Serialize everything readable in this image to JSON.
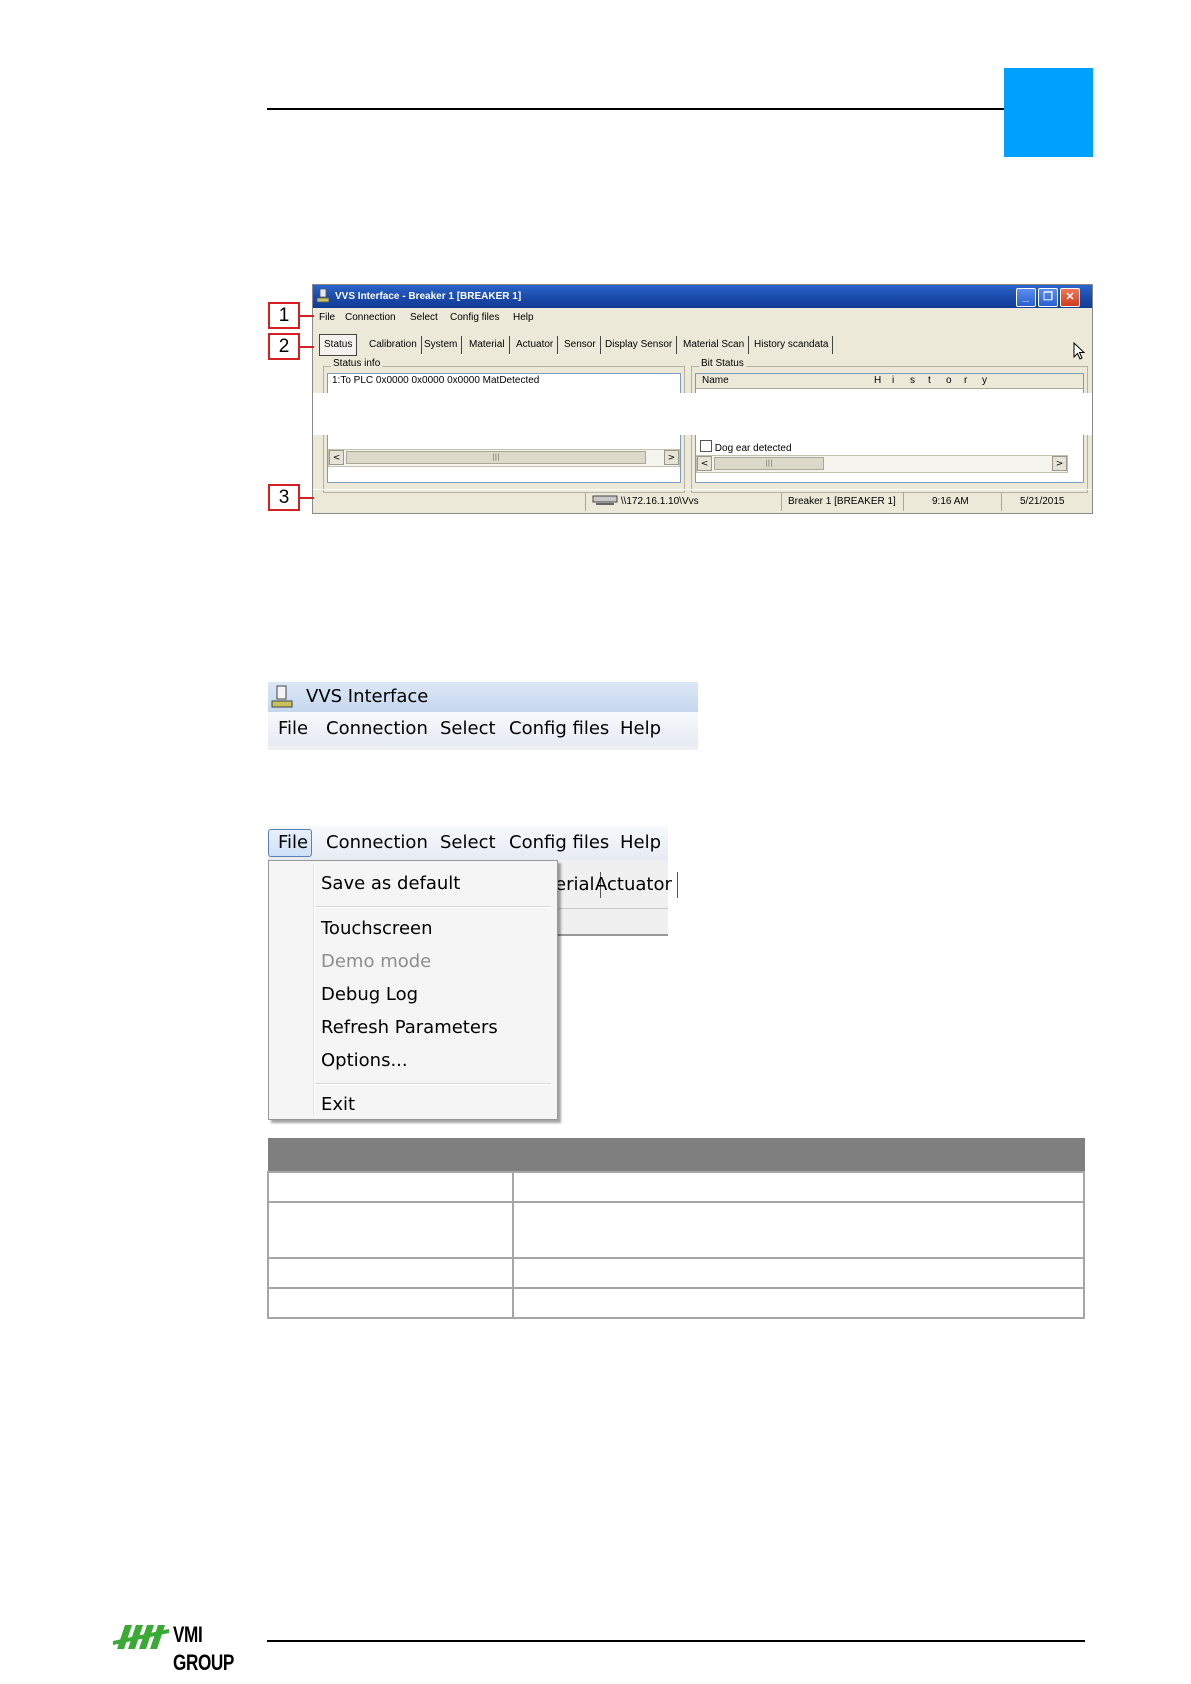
{
  "screenshot1": {
    "title": "VVS Interface - Breaker 1  [BREAKER 1]",
    "menu": [
      "File",
      "Connection",
      "Select",
      "Config files",
      "Help"
    ],
    "tabs": [
      "Status",
      "Calibration",
      "System",
      "Material",
      "Actuator",
      "Sensor",
      "Display Sensor",
      "Material Scan",
      "History scandata"
    ],
    "status_info_label": "Status info",
    "status_info_row": "1:To PLC 0x0000 0x0000 0x0000    MatDetected",
    "bit_status_label": "Bit Status",
    "bit_status_header": "Name",
    "bit_status_columns": [
      "H",
      "i",
      "s",
      "t",
      "o",
      "r",
      "y"
    ],
    "bit_status_row": "Dog ear detected",
    "status_bar": {
      "path": "\\\\172.16.1.10\\Vvs",
      "breaker": "Breaker 1  [BREAKER 1]",
      "time": "9:16 AM",
      "date": "5/21/2015"
    }
  },
  "callouts": [
    "1",
    "2",
    "3"
  ],
  "screenshot2": {
    "title": "VVS Interface",
    "menu": [
      "File",
      "Connection",
      "Select",
      "Config files",
      "Help"
    ]
  },
  "screenshot3": {
    "menu": [
      "File",
      "Connection",
      "Select",
      "Config files",
      "Help"
    ],
    "behind_tabs": [
      "erial",
      "Actuator"
    ],
    "dropdown": {
      "group1": [
        "Save as default"
      ],
      "group2": [
        "Touchscreen",
        "Demo mode",
        "Debug Log",
        "Refresh Parameters",
        "Options..."
      ],
      "group3": [
        "Exit"
      ],
      "disabled_item": "Demo mode"
    }
  },
  "footer": {
    "logo_text": "VMI GROUP"
  },
  "colors": {
    "accent_blue": "#00a0ff",
    "callout_red": "#d42020",
    "logo_green": "#3aa935",
    "table_header": "#7f7f7f"
  }
}
